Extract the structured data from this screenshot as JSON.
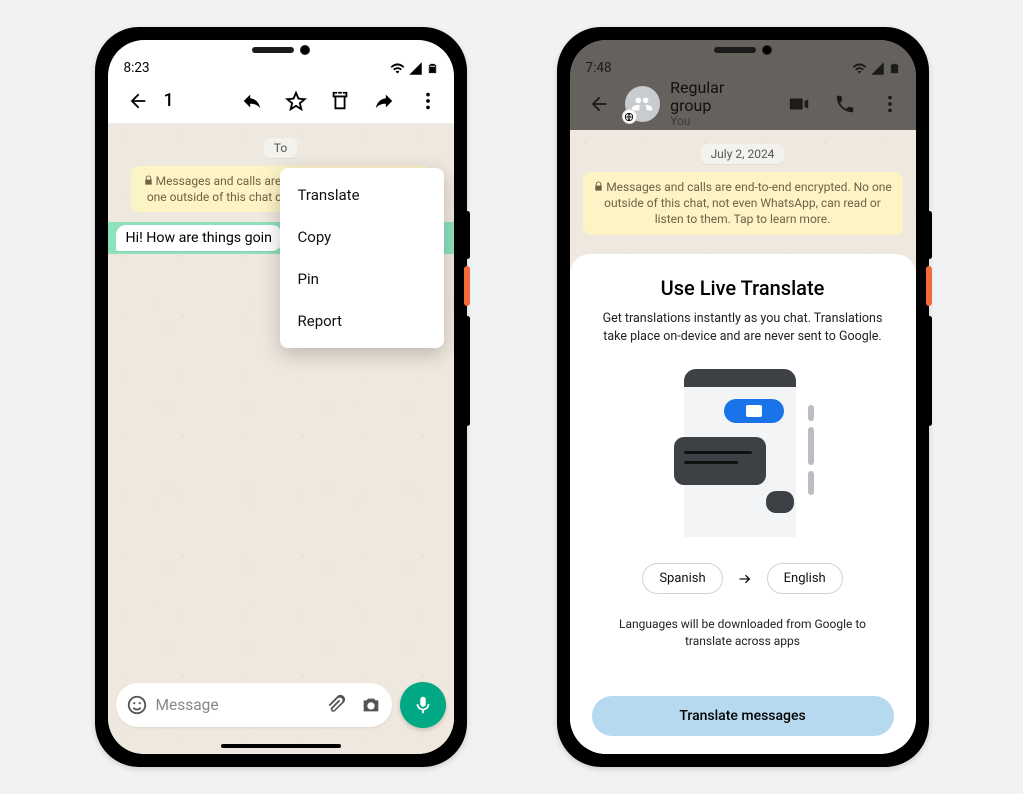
{
  "phoneA": {
    "status": {
      "time": "8:23"
    },
    "toolbar": {
      "count": "1",
      "menu_items": [
        "Translate",
        "Copy",
        "Pin",
        "Report"
      ]
    },
    "chat": {
      "day": "To",
      "encryption": "Messages and calls are end-to-end encrypted. No one outside of this chat can read or listen to them.",
      "message": "Hi! How are things goin",
      "compose_placeholder": "Message"
    }
  },
  "phoneB": {
    "status": {
      "time": "7:48"
    },
    "header": {
      "title": "Regular group",
      "subtitle": "You"
    },
    "chat": {
      "day": "July 2, 2024",
      "encryption": "Messages and calls are end-to-end encrypted. No one outside of this chat, not even WhatsApp, can read or listen to them. Tap to learn more."
    },
    "sheet": {
      "title": "Use Live Translate",
      "desc": "Get translations instantly as you chat. Translations take place on-device and are never sent to Google.",
      "from_lang": "Spanish",
      "to_lang": "English",
      "note": "Languages will be downloaded from Google to translate across apps",
      "cta": "Translate messages"
    }
  }
}
